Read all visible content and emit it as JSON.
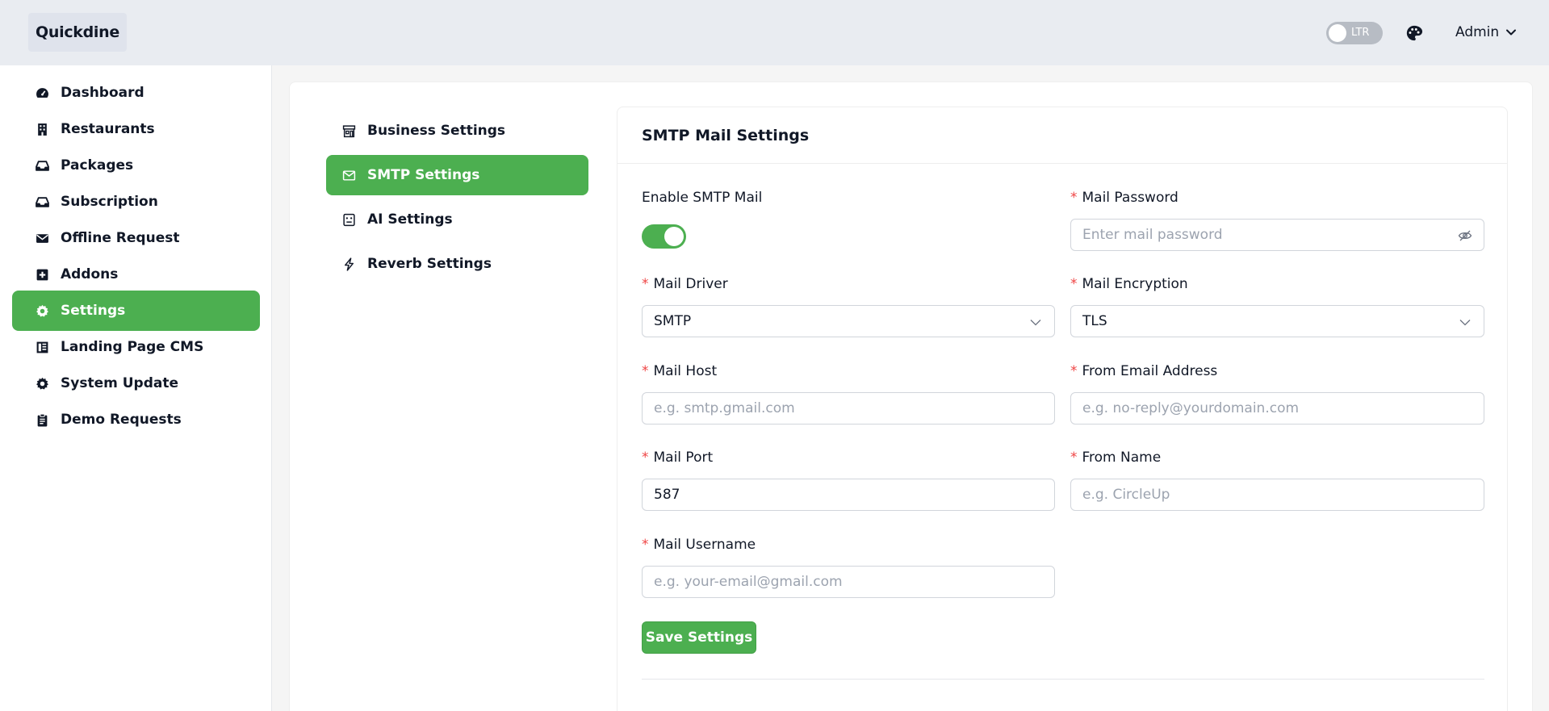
{
  "header": {
    "logo": "Quickdine",
    "direction_label": "LTR",
    "user_label": "Admin"
  },
  "sidebar": {
    "items": [
      {
        "label": "Dashboard",
        "icon": "gauge-icon"
      },
      {
        "label": "Restaurants",
        "icon": "building-icon"
      },
      {
        "label": "Packages",
        "icon": "inbox-icon"
      },
      {
        "label": "Subscription",
        "icon": "inbox-icon"
      },
      {
        "label": "Offline Request",
        "icon": "envelope-icon"
      },
      {
        "label": "Addons",
        "icon": "plus-square-icon"
      },
      {
        "label": "Settings",
        "icon": "gear-icon",
        "active": true
      },
      {
        "label": "Landing Page CMS",
        "icon": "layout-icon"
      },
      {
        "label": "System Update",
        "icon": "gear-icon"
      },
      {
        "label": "Demo Requests",
        "icon": "clipboard-icon"
      }
    ]
  },
  "settings_nav": {
    "items": [
      {
        "label": "Business Settings",
        "icon": "store-icon"
      },
      {
        "label": "SMTP Settings",
        "icon": "mail-icon",
        "active": true
      },
      {
        "label": "AI Settings",
        "icon": "robot-icon"
      },
      {
        "label": "Reverb Settings",
        "icon": "bolt-icon"
      }
    ]
  },
  "form": {
    "title": "SMTP Mail Settings",
    "enable_label": "Enable SMTP Mail",
    "enabled": true,
    "mail_password": {
      "label": "Mail Password",
      "placeholder": "Enter mail password"
    },
    "mail_driver": {
      "label": "Mail Driver",
      "value": "SMTP"
    },
    "mail_encryption": {
      "label": "Mail Encryption",
      "value": "TLS"
    },
    "mail_host": {
      "label": "Mail Host",
      "placeholder": "e.g. smtp.gmail.com"
    },
    "from_email": {
      "label": "From Email Address",
      "placeholder": "e.g. no-reply@yourdomain.com"
    },
    "mail_port": {
      "label": "Mail Port",
      "value": "587"
    },
    "from_name": {
      "label": "From Name",
      "placeholder": "e.g. CircleUp"
    },
    "mail_username": {
      "label": "Mail Username",
      "placeholder": "e.g. your-email@gmail.com"
    },
    "save_label": "Save Settings"
  },
  "colors": {
    "accent": "#4caf50",
    "required": "#ef4444"
  }
}
